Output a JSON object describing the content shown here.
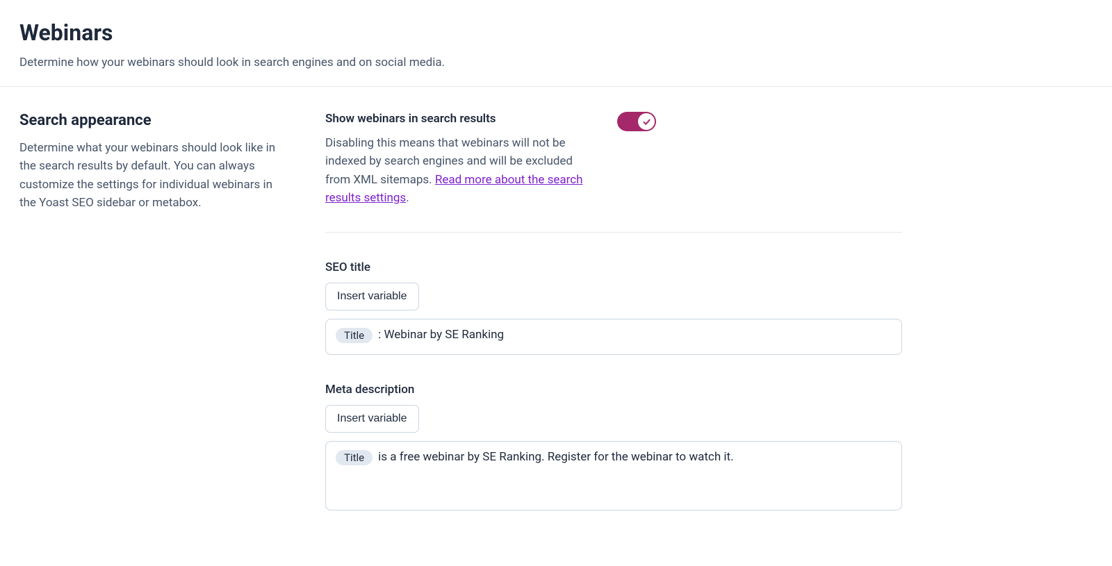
{
  "header": {
    "title": "Webinars",
    "subtitle": "Determine how your webinars should look in search engines and on social media."
  },
  "sidebar": {
    "title": "Search appearance",
    "desc": "Determine what your webinars should look like in the search results by default. You can always customize the settings for individual webinars in the Yoast SEO sidebar or metabox."
  },
  "toggle": {
    "label": "Show webinars in search results",
    "desc_before": "Disabling this means that webinars will not be indexed by search engines and will be excluded from XML sitemaps. ",
    "link": "Read more about the search results settings",
    "desc_after": ".",
    "state": true
  },
  "seo_title": {
    "label": "SEO title",
    "insert_btn": "Insert variable",
    "pill": "Title",
    "text": " : Webinar by SE Ranking"
  },
  "meta_desc": {
    "label": "Meta description",
    "insert_btn": "Insert variable",
    "pill": "Title",
    "text": " is a free webinar by SE Ranking. Register for the webinar to watch it."
  }
}
